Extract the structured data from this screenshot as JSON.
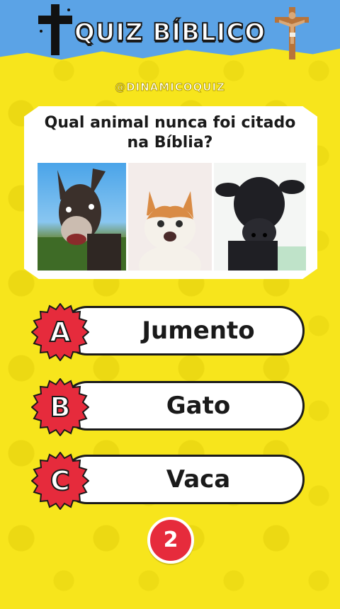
{
  "header": {
    "title": "QUIZ BÍBLICO",
    "left_icon": "cross-icon",
    "right_icon": "crucifix-icon",
    "bar_color": "#5ba3e6"
  },
  "handle": "@DINAMICOQUIZ",
  "question": {
    "text": "Qual animal nunca foi citado na Bíblia?",
    "images": [
      "donkey-photo",
      "cat-photo",
      "cow-photo"
    ]
  },
  "answers": [
    {
      "letter": "A",
      "label": "Jumento"
    },
    {
      "letter": "B",
      "label": "Gato"
    },
    {
      "letter": "C",
      "label": "Vaca"
    }
  ],
  "timer": {
    "value": "2",
    "color": "#e62b3c"
  },
  "colors": {
    "background": "#f7e51c",
    "badge": "#e62b3c"
  }
}
